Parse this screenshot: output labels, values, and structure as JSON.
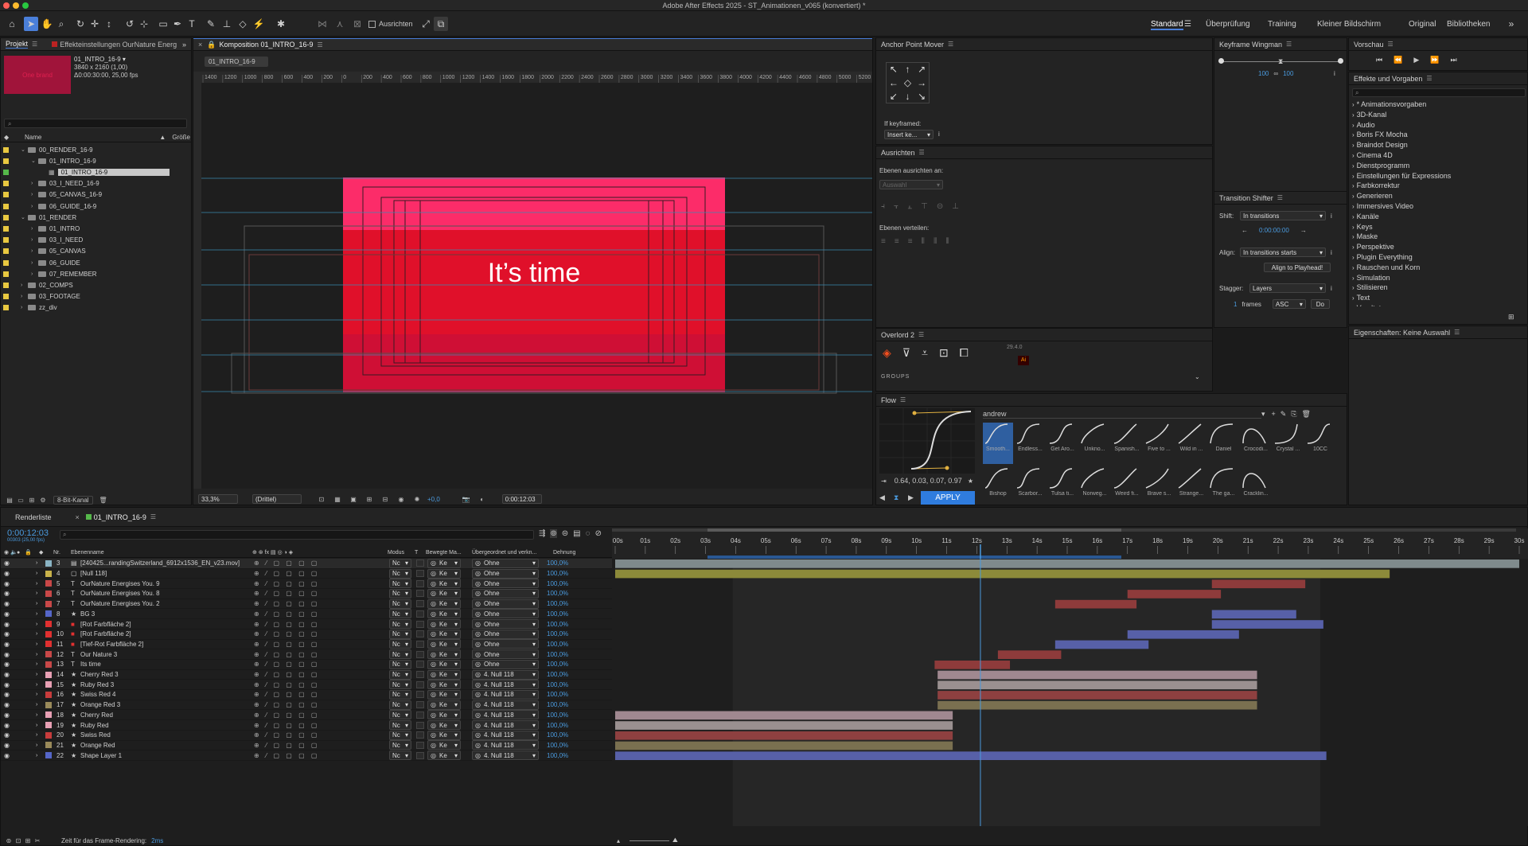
{
  "window": {
    "title": "Adobe After Effects 2025 - ST_Animationen_v065 (konvertiert) *"
  },
  "workspaces": [
    "Standard",
    "Überprüfung",
    "Training",
    "Kleiner Bildschirm",
    "Original",
    "Bibliotheken"
  ],
  "toolbar": {
    "align_label": "Ausrichten"
  },
  "project": {
    "tab": "Projekt",
    "effects_tab": "Effekteinstellungen OurNature Energ",
    "thumb_text": "One brand",
    "item_name": "01_INTRO_16-9 ▾",
    "item_res": "3840 x 2160 (1,00)",
    "item_dur": "Δ0:00:30:00, 25,00 fps",
    "search_placeholder": "",
    "col_name": "Name",
    "col_size": "Größe",
    "items": [
      {
        "label": "00_RENDER_16-9",
        "indent": 0,
        "open": true,
        "color": "#e8c840",
        "type": "folder"
      },
      {
        "label": "01_INTRO_16-9",
        "indent": 1,
        "open": true,
        "color": "#e8c840",
        "type": "folder"
      },
      {
        "label": "01_INTRO_16-9",
        "indent": 2,
        "open": false,
        "color": "#55b84a",
        "type": "comp",
        "selected": true
      },
      {
        "label": "03_I_NEED_16-9",
        "indent": 1,
        "open": false,
        "color": "#e8c840",
        "type": "folder"
      },
      {
        "label": "05_CANVAS_16-9",
        "indent": 1,
        "open": false,
        "color": "#e8c840",
        "type": "folder"
      },
      {
        "label": "06_GUIDE_16-9",
        "indent": 1,
        "open": false,
        "color": "#e8c840",
        "type": "folder"
      },
      {
        "label": "01_RENDER",
        "indent": 0,
        "open": true,
        "color": "#e8c840",
        "type": "folder"
      },
      {
        "label": "01_INTRO",
        "indent": 1,
        "open": false,
        "color": "#e8c840",
        "type": "folder"
      },
      {
        "label": "03_I_NEED",
        "indent": 1,
        "open": false,
        "color": "#e8c840",
        "type": "folder"
      },
      {
        "label": "05_CANVAS",
        "indent": 1,
        "open": false,
        "color": "#e8c840",
        "type": "folder"
      },
      {
        "label": "06_GUIDE",
        "indent": 1,
        "open": false,
        "color": "#e8c840",
        "type": "folder"
      },
      {
        "label": "07_REMEMBER",
        "indent": 1,
        "open": false,
        "color": "#e8c840",
        "type": "folder"
      },
      {
        "label": "02_COMPS",
        "indent": 0,
        "open": false,
        "color": "#e8c840",
        "type": "folder"
      },
      {
        "label": "03_FOOTAGE",
        "indent": 0,
        "open": false,
        "color": "#e8c840",
        "type": "folder"
      },
      {
        "label": "zz_div",
        "indent": 0,
        "open": false,
        "color": "#e8c840",
        "type": "folder"
      }
    ],
    "bit_depth": "8-Bit-Kanal"
  },
  "comp": {
    "tab": "Komposition 01_INTRO_16-9",
    "subtab": "01_INTRO_16-9",
    "ruler": [
      "1400",
      "1200",
      "1000",
      "800",
      "600",
      "400",
      "200",
      "0",
      "200",
      "400",
      "600",
      "800",
      "1000",
      "1200",
      "1400",
      "1600",
      "1800",
      "2000",
      "2200",
      "2400",
      "2600",
      "2800",
      "3000",
      "3200",
      "3400",
      "3600",
      "3800",
      "4000",
      "4200",
      "4400",
      "4600",
      "4800",
      "5000",
      "5200"
    ],
    "text": "It’s time",
    "zoom": "33,3%",
    "resolution": "(Drittel)",
    "exposure": "+0,0",
    "timecode": "0:00:12:03"
  },
  "anchor": {
    "title": "Anchor Point Mover",
    "if_keyframed": "If keyframed:",
    "insert": "Insert ke..."
  },
  "align": {
    "title": "Ausrichten",
    "align_to": "Ebenen ausrichten an:",
    "selection": "Auswahl",
    "distribute": "Ebenen verteilen:"
  },
  "overlord": {
    "title": "Overlord 2",
    "version": "29.4.0",
    "groups": "GROUPS"
  },
  "wingman": {
    "title": "Keyframe Wingman",
    "v1": "100",
    "v2": "100"
  },
  "shifter": {
    "title": "Transition Shifter",
    "shift_label": "Shift:",
    "shift_val": "In transitions",
    "time": "0:00:00:00",
    "align_label": "Align:",
    "align_val": "In transitions starts",
    "align_btn": "Align to Playhead!",
    "stagger_label": "Stagger:",
    "stagger_val": "Layers",
    "frames_n": "1",
    "frames_label": "frames",
    "order": "ASC",
    "do": "Do"
  },
  "flow": {
    "title": "Flow",
    "values": "0.64, 0.03, 0.07, 0.97",
    "preset": "andrew",
    "apply": "APPLY",
    "presets": [
      "Smooth...",
      "Endless...",
      "Get Aro...",
      "Unkno...",
      "Spanish...",
      "Five to ...",
      "Wild in ...",
      "Daniel",
      "Crocodi...",
      "Crystal ...",
      "10CC",
      "Bishop",
      "Scarbor...",
      "Tulsa ti...",
      "Norweg...",
      "Weird fi...",
      "Brave s...",
      "Strange...",
      "The ga...",
      "Cracklin..."
    ]
  },
  "preview": {
    "title": "Vorschau"
  },
  "effects": {
    "title": "Effekte und Vorgaben",
    "items": [
      "* Animationsvorgaben",
      "3D-Kanal",
      "Audio",
      "Boris FX Mocha",
      "Braindot Design",
      "Cinema 4D",
      "Dienstprogramm",
      "Einstellungen für Expressions",
      "Farbkorrektur",
      "Generieren",
      "Immersives Video",
      "Kanäle",
      "Keys",
      "Maske",
      "Perspektive",
      "Plugin Everything",
      "Rauschen und Korn",
      "Simulation",
      "Stilisieren",
      "Text",
      "Veraltet"
    ]
  },
  "properties": {
    "title": "Eigenschaften: Keine Auswahl"
  },
  "timeline": {
    "render_tab": "Renderliste",
    "comp_tab": "01_INTRO_16-9",
    "timecode": "0:00:12:03",
    "fps": "00303 (25,00 fps)",
    "headers": {
      "nr": "Nr.",
      "name": "Ebenenname",
      "mode": "Modus",
      "t": "T",
      "track": "Bewegte Ma...",
      "parent": "Übergeordnet und verkn...",
      "stretch": "Dehnung"
    },
    "ticks": [
      "0:00s",
      "01s",
      "02s",
      "03s",
      "04s",
      "05s",
      "06s",
      "07s",
      "08s",
      "09s",
      "10s",
      "11s",
      "12s",
      "13s",
      "14s",
      "15s",
      "16s",
      "17s",
      "18s",
      "19s",
      "20s",
      "21s",
      "22s",
      "23s",
      "24s",
      "25s",
      "26s",
      "27s",
      "28s",
      "29s",
      "30s"
    ],
    "layers": [
      {
        "n": "3",
        "name": "[240425...randingSwitzerland_6912x1536_EN_v23.mov]",
        "color": "#8ab4c4",
        "type": "▤",
        "mode": "Nc",
        "track": "Ke",
        "parent": "Ohne",
        "stretch": "100,0%",
        "bar": [
          0,
          30
        ],
        "barcolor": "#7f8a8c"
      },
      {
        "n": "4",
        "name": "[Null 118]",
        "color": "#c8b24a",
        "type": "▢",
        "mode": "Nc",
        "track": "Ke",
        "parent": "Ohne",
        "stretch": "100,0%",
        "bar": [
          0,
          25.7
        ],
        "barcolor": "#8c8a3a"
      },
      {
        "n": "5",
        "name": "OurNature Energises You. 9",
        "color": "#c84848",
        "type": "T",
        "mode": "Nc",
        "track": "Ke",
        "parent": "Ohne",
        "stretch": "100,0%",
        "bar": [
          19.8,
          22.9
        ],
        "barcolor": "#8e3b3b"
      },
      {
        "n": "6",
        "name": "OurNature Energises You. 8",
        "color": "#c84848",
        "type": "T",
        "mode": "Nc",
        "track": "Ke",
        "parent": "Ohne",
        "stretch": "100,0%",
        "bar": [
          17,
          20.1
        ],
        "barcolor": "#8e3b3b"
      },
      {
        "n": "7",
        "name": "OurNature Energises You. 2",
        "color": "#c84848",
        "type": "T",
        "mode": "Nc",
        "track": "Ke",
        "parent": "Ohne",
        "stretch": "100,0%",
        "bar": [
          14.6,
          17.3
        ],
        "barcolor": "#8e3b3b"
      },
      {
        "n": "8",
        "name": "BG 3",
        "color": "#5566c8",
        "type": "★",
        "mode": "Nc",
        "track": "Ke",
        "parent": "Ohne",
        "stretch": "100,0%",
        "bar": [
          19.8,
          22.6
        ],
        "barcolor": "#5760a8"
      },
      {
        "n": "9",
        "name": "[Rot Farbfläche 2]",
        "color": "#e03030",
        "type": "■",
        "mode": "Nc",
        "track": "Ke",
        "parent": "Ohne",
        "stretch": "100,0%",
        "bar": [
          19.8,
          23.5
        ],
        "barcolor": "#5760a8"
      },
      {
        "n": "10",
        "name": "[Rot Farbfläche 2]",
        "color": "#e03030",
        "type": "■",
        "mode": "Nc",
        "track": "Ke",
        "parent": "Ohne",
        "stretch": "100,0%",
        "bar": [
          17,
          20.7
        ],
        "barcolor": "#5760a8"
      },
      {
        "n": "11",
        "name": "[Tief-Rot Farbfläche 2]",
        "color": "#e03030",
        "type": "■",
        "mode": "Nc",
        "track": "Ke",
        "parent": "Ohne",
        "stretch": "100,0%",
        "bar": [
          14.6,
          17.7
        ],
        "barcolor": "#5760a8"
      },
      {
        "n": "12",
        "name": "Our Nature 3",
        "color": "#c84848",
        "type": "T",
        "mode": "Nc",
        "track": "Ke",
        "parent": "Ohne",
        "stretch": "100,0%",
        "bar": [
          12.7,
          14.8
        ],
        "barcolor": "#8e3b3b"
      },
      {
        "n": "13",
        "name": "Its time",
        "color": "#c84848",
        "type": "T",
        "mode": "Nc",
        "track": "Ke",
        "parent": "Ohne",
        "stretch": "100,0%",
        "bar": [
          10.6,
          13.1
        ],
        "barcolor": "#8e3b3b"
      },
      {
        "n": "14",
        "name": "Cherry Red 3",
        "color": "#e8a0b4",
        "type": "★",
        "mode": "Nc",
        "track": "Ke",
        "parent": "4. Null 118",
        "stretch": "100,0%",
        "bar": [
          10.7,
          21.3
        ],
        "barcolor": "#a08890"
      },
      {
        "n": "15",
        "name": "Ruby Red 3",
        "color": "#e8a0b4",
        "type": "★",
        "mode": "Nc",
        "track": "Ke",
        "parent": "4. Null 118",
        "stretch": "100,0%",
        "bar": [
          10.7,
          21.3
        ],
        "barcolor": "#9a9090"
      },
      {
        "n": "16",
        "name": "Swiss Red 4",
        "color": "#c83c3c",
        "type": "★",
        "mode": "Nc",
        "track": "Ke",
        "parent": "4. Null 118",
        "stretch": "100,0%",
        "bar": [
          10.7,
          21.3
        ],
        "barcolor": "#8e4040"
      },
      {
        "n": "17",
        "name": "Orange Red 3",
        "color": "#9a8a5a",
        "type": "★",
        "mode": "Nc",
        "track": "Ke",
        "parent": "4. Null 118",
        "stretch": "100,0%",
        "bar": [
          10.7,
          21.3
        ],
        "barcolor": "#7a7050"
      },
      {
        "n": "18",
        "name": "Cherry Red",
        "color": "#e8a0b4",
        "type": "★",
        "mode": "Nc",
        "track": "Ke",
        "parent": "4. Null 118",
        "stretch": "100,0%",
        "bar": [
          0,
          11.2
        ],
        "barcolor": "#a08890"
      },
      {
        "n": "19",
        "name": "Ruby Red",
        "color": "#e8a0b4",
        "type": "★",
        "mode": "Nc",
        "track": "Ke",
        "parent": "4. Null 118",
        "stretch": "100,0%",
        "bar": [
          0,
          11.2
        ],
        "barcolor": "#9a9090"
      },
      {
        "n": "20",
        "name": "Swiss Red",
        "color": "#c83c3c",
        "type": "★",
        "mode": "Nc",
        "track": "Ke",
        "parent": "4. Null 118",
        "stretch": "100,0%",
        "bar": [
          0,
          11.2
        ],
        "barcolor": "#8e4040"
      },
      {
        "n": "21",
        "name": "Orange Red",
        "color": "#9a8a5a",
        "type": "★",
        "mode": "Nc",
        "track": "Ke",
        "parent": "4. Null 118",
        "stretch": "100,0%",
        "bar": [
          0,
          11.2
        ],
        "barcolor": "#7a7050"
      },
      {
        "n": "22",
        "name": "Shape Layer 1",
        "color": "#5566c8",
        "type": "★",
        "mode": "Nc",
        "track": "Ke",
        "parent": "4. Null 118",
        "stretch": "100,0%",
        "bar": [
          0,
          23.6
        ],
        "barcolor": "#5760a8"
      }
    ],
    "playhead_sec": 12.12,
    "status": "Zeit für das Frame-Rendering:",
    "status_val": "2ms"
  }
}
